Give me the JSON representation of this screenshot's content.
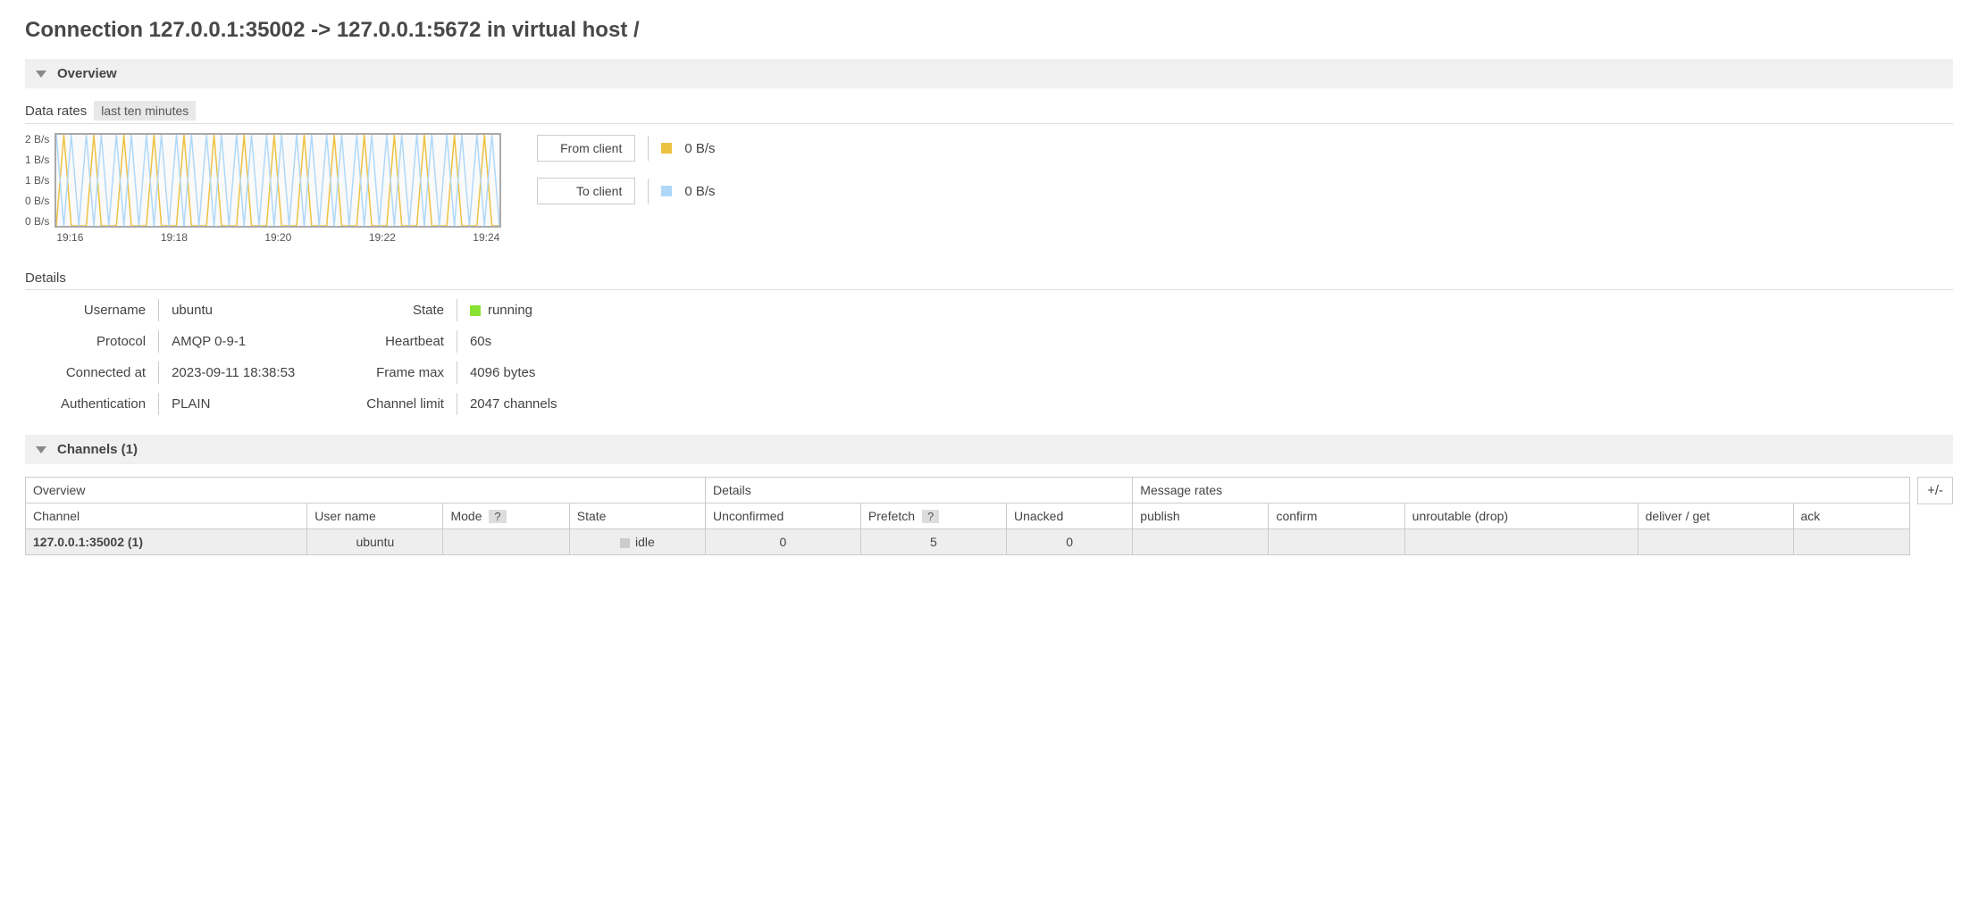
{
  "page_title": "Connection 127.0.0.1:35002 -> 127.0.0.1:5672 in virtual host /",
  "overview_section_title": "Overview",
  "data_rates_label": "Data rates",
  "data_rates_range": "last ten minutes",
  "legend": {
    "from_client_label": "From client",
    "from_client_value": "0 B/s",
    "to_client_label": "To client",
    "to_client_value": "0 B/s"
  },
  "colors": {
    "from_client": "#edc240",
    "to_client": "#afd8f8"
  },
  "details_label": "Details",
  "details": {
    "left": [
      {
        "label": "Username",
        "value": "ubuntu"
      },
      {
        "label": "Protocol",
        "value": "AMQP 0-9-1"
      },
      {
        "label": "Connected at",
        "value": "2023-09-11 18:38:53"
      },
      {
        "label": "Authentication",
        "value": "PLAIN"
      }
    ],
    "right": [
      {
        "label": "State",
        "value": "running",
        "state_color": "#8ae234"
      },
      {
        "label": "Heartbeat",
        "value": "60s"
      },
      {
        "label": "Frame max",
        "value": "4096 bytes"
      },
      {
        "label": "Channel limit",
        "value": "2047 channels"
      }
    ]
  },
  "channels_section_title": "Channels (1)",
  "plusminus_label": "+/-",
  "channels_table": {
    "group_headers": [
      "Overview",
      "Details",
      "Message rates"
    ],
    "sub_headers": [
      "Channel",
      "User name",
      "Mode",
      "State",
      "Unconfirmed",
      "Prefetch",
      "Unacked",
      "publish",
      "confirm",
      "unroutable (drop)",
      "deliver / get",
      "ack"
    ],
    "help_on_cols": [
      2,
      5
    ],
    "rows": [
      {
        "channel": "127.0.0.1:35002 (1)",
        "user": "ubuntu",
        "mode": "",
        "state": "idle",
        "unconfirmed": "0",
        "prefetch": "5",
        "unacked": "0",
        "publish": "",
        "confirm": "",
        "unroutable": "",
        "deliver_get": "",
        "ack": ""
      }
    ]
  },
  "chart_data": {
    "type": "line",
    "title": "Data rates",
    "xlabel": "",
    "ylabel": "B/s",
    "y_ticks": [
      "2 B/s",
      "1 B/s",
      "1 B/s",
      "0 B/s",
      "0 B/s"
    ],
    "x_ticks": [
      "19:16",
      "19:18",
      "19:20",
      "19:22",
      "19:24"
    ],
    "ylim": [
      0,
      2
    ],
    "series": [
      {
        "name": "From client",
        "color": "#edc240",
        "values": [
          0,
          2,
          0,
          0,
          0,
          2,
          0,
          0,
          0,
          2,
          0,
          0,
          0,
          2,
          0,
          0,
          0,
          2,
          0,
          0,
          0,
          2,
          0,
          0,
          0,
          2,
          0,
          0,
          0,
          2,
          0,
          0,
          0,
          2,
          0,
          0,
          0,
          2,
          0,
          0,
          0,
          2,
          0,
          0,
          0,
          2,
          0,
          0,
          0,
          2,
          0,
          0,
          0,
          2,
          0,
          0,
          0,
          2,
          0,
          0
        ]
      },
      {
        "name": "To client",
        "color": "#afd8f8",
        "values": [
          2,
          0,
          2,
          0,
          2,
          0,
          2,
          0,
          2,
          0,
          2,
          0,
          2,
          0,
          2,
          0,
          2,
          0,
          2,
          0,
          2,
          0,
          2,
          0,
          2,
          0,
          2,
          0,
          2,
          0,
          2,
          0,
          2,
          0,
          2,
          0,
          2,
          0,
          2,
          0,
          2,
          0,
          2,
          0,
          2,
          0,
          2,
          0,
          2,
          0,
          2,
          0,
          2,
          0,
          2,
          0,
          2,
          0,
          2,
          0
        ]
      }
    ]
  }
}
